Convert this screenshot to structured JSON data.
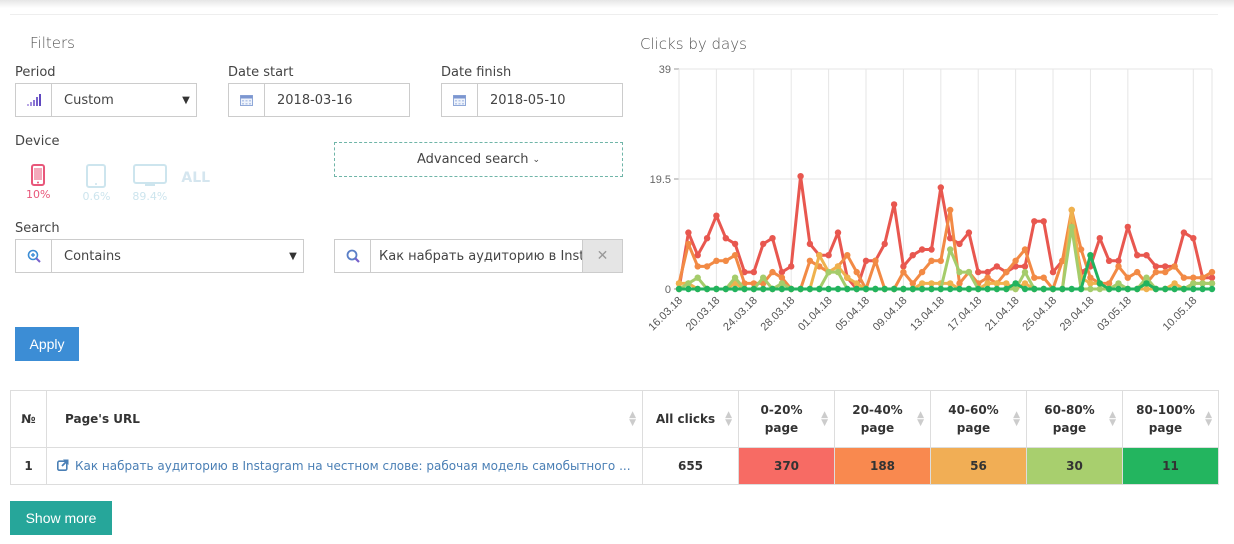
{
  "filters": {
    "title": "Filters",
    "period": {
      "label": "Period",
      "value": "Custom",
      "icon": "signal-bars-icon"
    },
    "date_start": {
      "label": "Date start",
      "value": "2018-03-16",
      "icon": "calendar-icon"
    },
    "date_finish": {
      "label": "Date finish",
      "value": "2018-05-10",
      "icon": "calendar-icon"
    },
    "advanced_search": {
      "label": "Advanced search",
      "icon": "chevron-down-icon"
    },
    "device": {
      "label": "Device",
      "items": [
        {
          "name": "mobile",
          "icon": "mobile-phone-icon",
          "percent": "10%",
          "active": true,
          "color": "#e8577a"
        },
        {
          "name": "tablet",
          "icon": "tablet-icon",
          "percent": "0.6%",
          "active": false,
          "color": "#cde5ee"
        },
        {
          "name": "desktop",
          "icon": "desktop-icon",
          "percent": "89.4%",
          "active": false,
          "color": "#cde5ee"
        }
      ],
      "all_label": "ALL"
    },
    "search": {
      "label": "Search",
      "mode": "Contains",
      "mode_icon": "zoom-in-icon",
      "query": "Как набрать аудиторию в Instagram на честном слове: рабочая модель самобытного ...",
      "query_icon": "search-icon",
      "clear_icon": "close-icon"
    },
    "apply_label": "Apply"
  },
  "chart_data": {
    "type": "line",
    "title": "Clicks by days",
    "xlabel": "",
    "ylabel": "",
    "ylim": [
      0,
      39
    ],
    "yticks": [
      0,
      19.5,
      39
    ],
    "grid": true,
    "legend": "none",
    "x_start": "16.03.18",
    "x_end": "10.05.18",
    "xtick_labels": [
      "16.03.18",
      "20.03.18",
      "24.03.18",
      "28.03.18",
      "01.04.18",
      "05.04.18",
      "09.04.18",
      "13.04.18",
      "17.04.18",
      "21.04.18",
      "25.04.18",
      "29.04.18",
      "03.05.18",
      "10.05.18"
    ],
    "xtick_day_index": [
      0,
      4,
      8,
      12,
      16,
      20,
      24,
      28,
      32,
      36,
      40,
      44,
      48,
      55
    ],
    "series": [
      {
        "name": "0-20% page",
        "color": "#e8574f",
        "values": [
          0,
          10,
          6,
          9,
          13,
          9,
          8,
          3,
          3,
          8,
          9,
          3,
          4,
          20,
          8,
          6,
          6,
          10,
          2,
          0,
          5,
          5,
          8,
          15,
          4,
          6,
          7,
          7,
          18,
          9,
          8,
          10,
          3,
          3,
          4,
          3,
          4,
          4,
          12,
          12,
          3,
          5,
          12,
          3,
          4,
          9,
          5,
          5,
          11,
          6,
          6,
          4,
          4,
          4,
          10,
          9,
          2,
          2
        ]
      },
      {
        "name": "20-40% page",
        "color": "#f28a45",
        "values": [
          1,
          8,
          4,
          4,
          5,
          5,
          6,
          1,
          1,
          1,
          3,
          2,
          0,
          0,
          5,
          4,
          3,
          4,
          6,
          3,
          0,
          5,
          0,
          0,
          3,
          1,
          3,
          5,
          5,
          14,
          1,
          3,
          1,
          2,
          1,
          3,
          5,
          7,
          2,
          2,
          0,
          5,
          14,
          7,
          2,
          1,
          1,
          4,
          2,
          3,
          1,
          3,
          3,
          4,
          2,
          2,
          2,
          3
        ]
      },
      {
        "name": "40-60% page",
        "color": "#efb24e",
        "values": [
          1,
          1,
          0,
          0,
          0,
          0,
          1,
          0,
          0,
          0,
          0,
          0,
          0,
          0,
          0,
          6,
          3,
          4,
          2,
          1,
          0,
          0,
          0,
          0,
          0,
          0,
          1,
          1,
          1,
          1,
          0,
          0,
          0,
          1,
          1,
          1,
          0,
          1,
          0,
          0,
          0,
          0,
          14,
          2,
          1,
          1,
          0,
          0,
          0,
          0,
          0,
          0,
          0,
          1,
          0,
          1,
          1,
          1
        ]
      },
      {
        "name": "60-80% page",
        "color": "#a5cc6b",
        "values": [
          0,
          1,
          2,
          0,
          0,
          0,
          2,
          0,
          0,
          2,
          0,
          1,
          0,
          0,
          0,
          0,
          3,
          3,
          0,
          0,
          0,
          0,
          0,
          0,
          0,
          0,
          0,
          0,
          0,
          7,
          3,
          3,
          0,
          0,
          0,
          0,
          0,
          3,
          0,
          0,
          0,
          0,
          11,
          0,
          0,
          0,
          0,
          1,
          0,
          0,
          2,
          0,
          0,
          0,
          0,
          1,
          1,
          1
        ]
      },
      {
        "name": "80-100% page",
        "color": "#22b35e",
        "values": [
          0,
          0,
          0,
          0,
          0,
          0,
          0,
          0,
          0,
          0,
          0,
          0,
          0,
          0,
          0,
          0,
          0,
          0,
          0,
          0,
          0,
          0,
          0,
          0,
          0,
          0,
          0,
          0,
          0,
          0,
          0,
          0,
          0,
          0,
          0,
          0,
          1,
          0,
          0,
          0,
          0,
          0,
          0,
          0,
          6,
          1,
          0,
          0,
          0,
          0,
          1,
          0,
          0,
          0,
          0,
          0,
          0,
          0
        ]
      }
    ]
  },
  "table": {
    "columns": [
      {
        "label": "№",
        "sortable": false
      },
      {
        "label": "Page's URL",
        "sortable": true
      },
      {
        "label": "All clicks",
        "sortable": true
      },
      {
        "label": "0-20% page",
        "sortable": true
      },
      {
        "label": "20-40% page",
        "sortable": true
      },
      {
        "label": "40-60% page",
        "sortable": true
      },
      {
        "label": "60-80% page",
        "sortable": true
      },
      {
        "label": "80-100% page",
        "sortable": true
      }
    ],
    "rows": [
      {
        "num": "1",
        "url_text": "Как набрать аудиторию в Instagram на честном слове: рабочая модель самобытного ...",
        "url_icon": "external-link-icon",
        "all_clicks": "655",
        "buckets": [
          "370",
          "188",
          "56",
          "30",
          "11"
        ]
      }
    ],
    "bucket_colors": [
      "#f76b64",
      "#f9894f",
      "#f1ae55",
      "#a8cf6e",
      "#23b55f"
    ]
  },
  "show_more_label": "Show more",
  "colors": {
    "apply": "#3c8dd5",
    "show_more": "#26a69a",
    "link": "#4a7fb5"
  }
}
